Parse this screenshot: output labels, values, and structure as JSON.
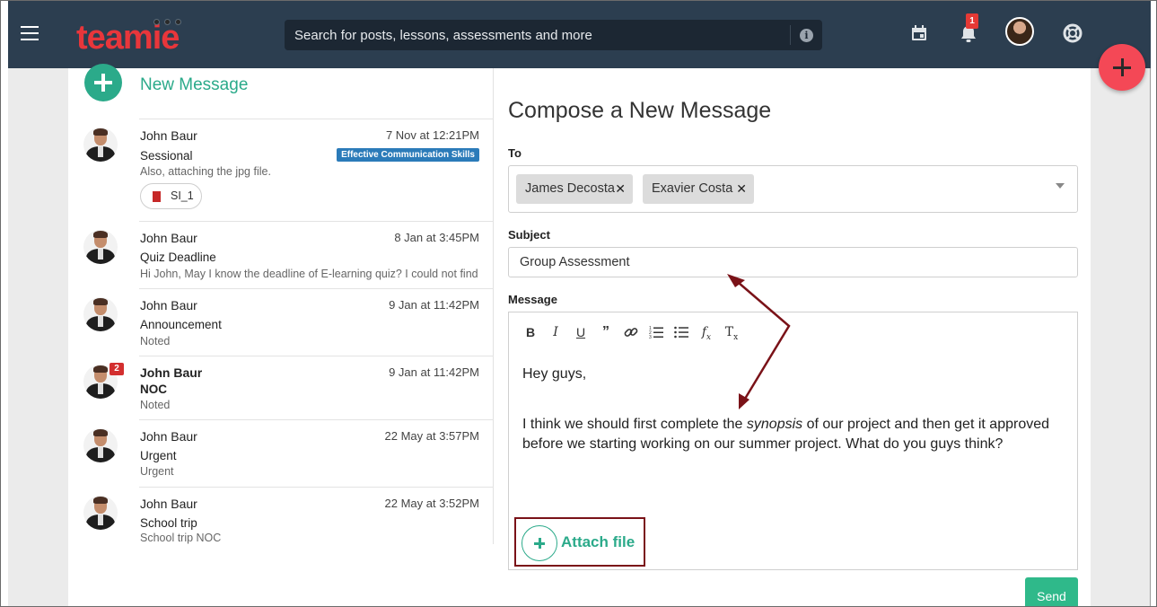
{
  "header": {
    "logo": "teamie",
    "search_placeholder": "Search for posts, lessons, assessments and more",
    "notification_count": "1"
  },
  "sidebar": {
    "new_message_label": "New Message",
    "messages": [
      {
        "name": "John Baur",
        "date": "7 Nov at 12:21PM",
        "subject": "Sessional",
        "snippet": "Also, attaching the jpg file.",
        "tag": "Effective Communication Skills",
        "attachment": "SI_1"
      },
      {
        "name": "John Baur",
        "date": "8 Jan at 3:45PM",
        "subject": "Quiz Deadline",
        "snippet": "Hi John, May I know the deadline of E-learning quiz? I could not find it anywhere."
      },
      {
        "name": "John Baur",
        "date": "9 Jan at 11:42PM",
        "subject": "Announcement",
        "snippet": "Noted"
      },
      {
        "name": "John Baur",
        "date": "9 Jan at 11:42PM",
        "subject": "NOC",
        "snippet": "Noted",
        "unread": "2"
      },
      {
        "name": "John Baur",
        "date": "22 May at 3:57PM",
        "subject": "Urgent",
        "snippet": "Urgent"
      },
      {
        "name": "John Baur",
        "date": "22 May at 3:52PM",
        "subject": "School trip",
        "snippet": "School trip NOC"
      }
    ]
  },
  "compose": {
    "title": "Compose a New Message",
    "to_label": "To",
    "recipients": [
      "James Decosta",
      "Exavier Costa"
    ],
    "subject_label": "Subject",
    "subject_value": "Group Assessment",
    "message_label": "Message",
    "body_line1": "Hey guys,",
    "body_line2_pre": "I think we should first complete the ",
    "body_line2_em": "synopsis",
    "body_line2_post": " of our project and then get it approved before we starting working on our summer project. What do you guys think?",
    "attach_label": "Attach file",
    "send_label": "Send"
  },
  "colors": {
    "topbar": "#2c3e50",
    "brand_red": "#e8363b",
    "accent_green": "#2baa8a",
    "annotation": "#7a1218"
  }
}
